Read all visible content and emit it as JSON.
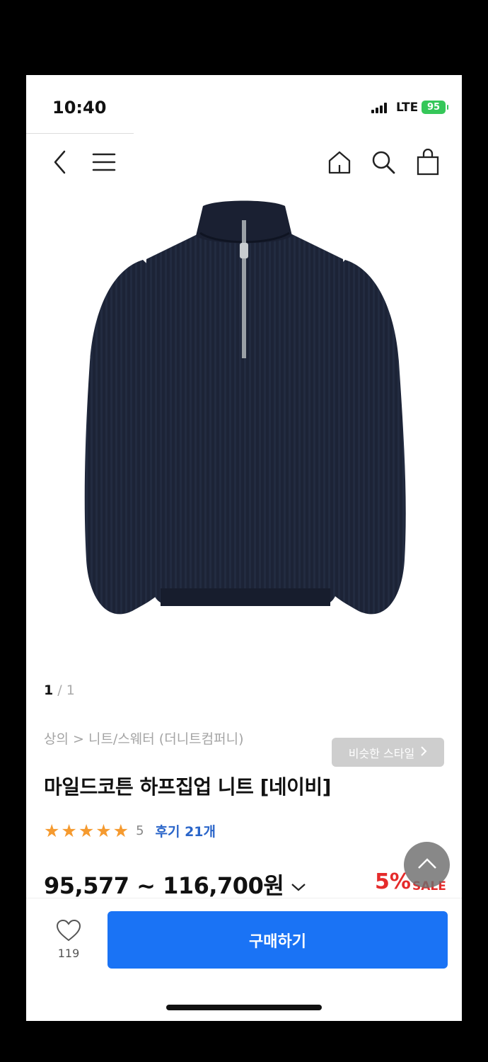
{
  "status": {
    "time": "10:40",
    "network": "LTE",
    "battery": "95"
  },
  "product": {
    "similar_style_label": "비슷한 스타일",
    "page_current": "1",
    "page_total": "1",
    "breadcrumb": "상의 > 니트/스웨터 (더니트컴퍼니)",
    "title": "마일드코튼 하프집업 니트 [네이비]",
    "stars": "★★★★★",
    "rating": "5",
    "reviews": "후기 21개",
    "price": "95,577 ~ 116,700원",
    "discount": "5%",
    "sale_label": "SALE"
  },
  "bottom": {
    "like_count": "119",
    "buy_label": "구매하기"
  },
  "colors": {
    "accent": "#1a73f5",
    "sale": "#e52b2b",
    "star": "#f59a2f",
    "sweater": "#1c2336"
  }
}
